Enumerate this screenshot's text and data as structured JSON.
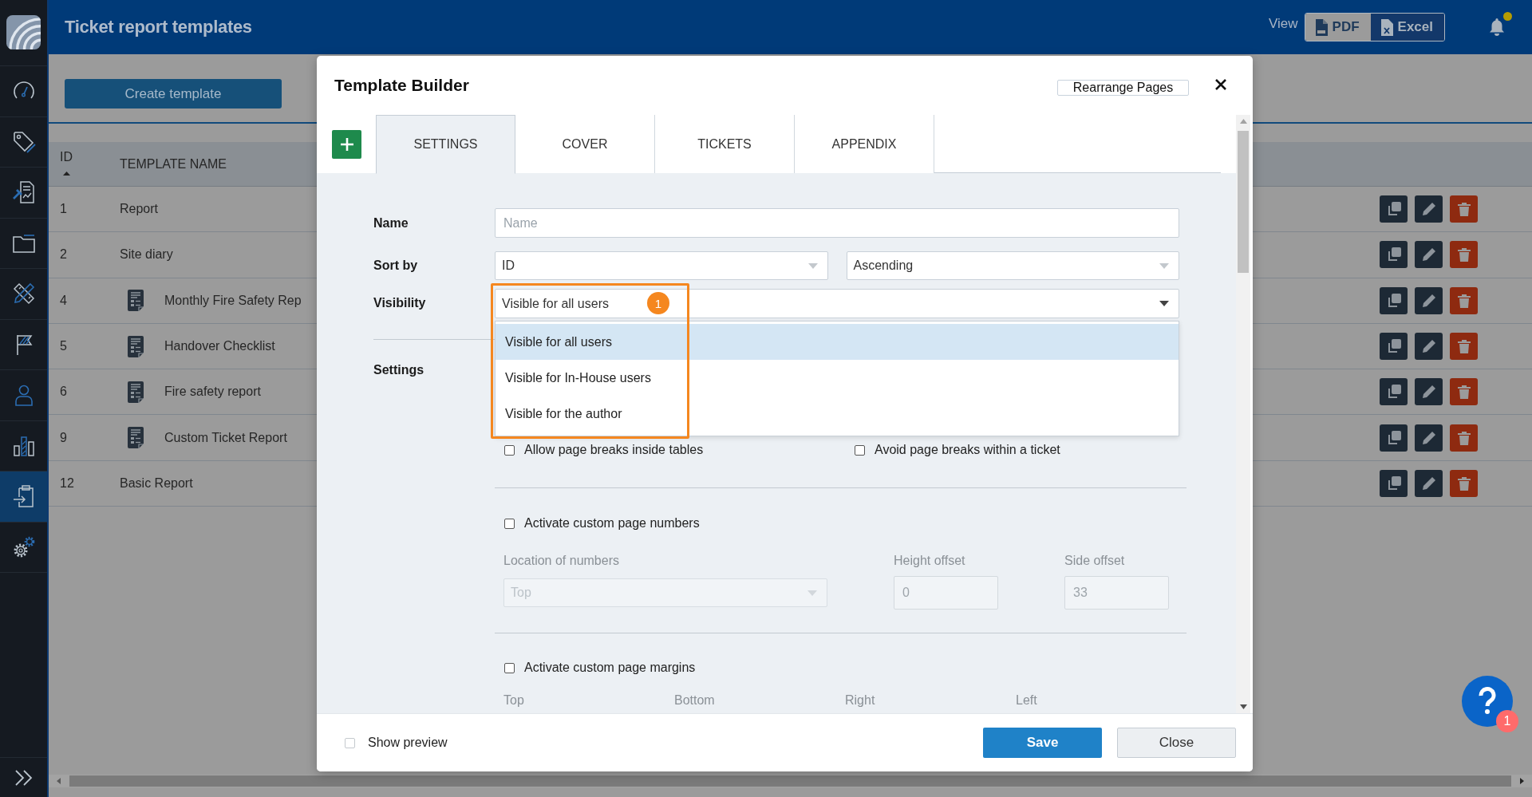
{
  "sidebar": {
    "items": [
      {
        "selected": false
      },
      {
        "selected": false
      },
      {
        "selected": false
      },
      {
        "selected": false
      },
      {
        "selected": false
      },
      {
        "selected": false
      },
      {
        "selected": false
      },
      {
        "selected": false
      },
      {
        "selected": true
      },
      {
        "selected": false
      }
    ]
  },
  "header": {
    "title": "Ticket report templates",
    "view_label": "View",
    "view_options": [
      {
        "label": "PDF",
        "selected": true
      },
      {
        "label": "Excel",
        "selected": false
      }
    ],
    "bell": {
      "unread": true
    }
  },
  "toolbar": {
    "create_button": "Create template"
  },
  "table": {
    "columns": [
      {
        "label": "ID",
        "sorted_ascending": true
      },
      {
        "label": "TEMPLATE NAME",
        "sorted_ascending": false
      }
    ],
    "rows": [
      {
        "id": "1",
        "name": "Report",
        "template_icon": false
      },
      {
        "id": "2",
        "name": "Site diary",
        "template_icon": false
      },
      {
        "id": "4",
        "name": "Monthly Fire Safety Rep",
        "template_icon": true
      },
      {
        "id": "5",
        "name": "Handover Checklist",
        "template_icon": true
      },
      {
        "id": "6",
        "name": "Fire safety report",
        "template_icon": true
      },
      {
        "id": "9",
        "name": "Custom Ticket Report",
        "template_icon": true
      },
      {
        "id": "12",
        "name": "Basic Report",
        "template_icon": false
      }
    ]
  },
  "modal": {
    "title": "Template Builder",
    "rearrange_button": "Rearrange Pages",
    "tabs": [
      {
        "label": "SETTINGS",
        "selected": true
      },
      {
        "label": "COVER",
        "selected": false
      },
      {
        "label": "TICKETS",
        "selected": false
      },
      {
        "label": "APPENDIX",
        "selected": false
      }
    ],
    "form": {
      "name": {
        "label": "Name",
        "placeholder": "Name"
      },
      "sort_by": {
        "label": "Sort by",
        "field": "ID",
        "order": "Ascending"
      },
      "visibility": {
        "label": "Visibility",
        "value": "Visible for all users",
        "step_badge": "1",
        "expanded": true,
        "options": [
          {
            "label": "Visible for all users",
            "selected": true
          },
          {
            "label": "Visible for In-House users",
            "selected": false
          },
          {
            "label": "Visible for the author",
            "selected": false
          }
        ]
      },
      "settings_label": "Settings",
      "checkboxes": [
        {
          "label": "Allow page breaks inside tables",
          "checked": false
        },
        {
          "label": "Avoid page breaks within a ticket",
          "checked": false
        }
      ],
      "page_numbers": {
        "label": "Activate custom page numbers",
        "checked": false,
        "location": {
          "label": "Location of numbers",
          "value": "Top",
          "disabled": true
        },
        "height_offset": {
          "label": "Height offset",
          "value": "0",
          "disabled": true
        },
        "side_offset": {
          "label": "Side offset",
          "value": "33",
          "disabled": true
        }
      },
      "page_margins": {
        "label": "Activate custom page margins",
        "checked": false,
        "fields": [
          "Top",
          "Bottom",
          "Right",
          "Left"
        ]
      }
    },
    "footer": {
      "show_preview": {
        "label": "Show preview",
        "checked": false
      },
      "buttons": [
        {
          "label": "Save",
          "kind": "primary"
        },
        {
          "label": "Close",
          "kind": "secondary"
        }
      ]
    }
  },
  "help": {
    "badge": "1"
  }
}
